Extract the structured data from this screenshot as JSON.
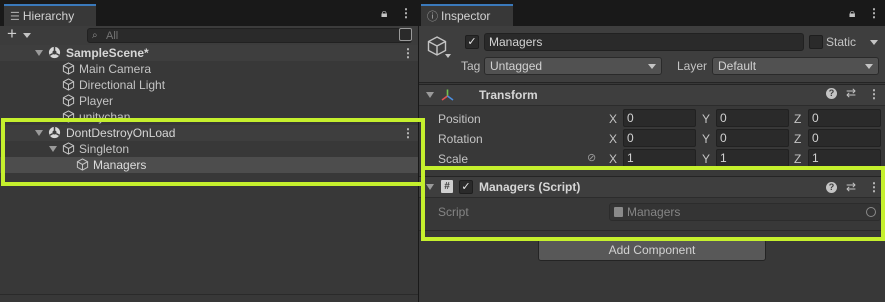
{
  "hierarchy": {
    "tab_label": "Hierarchy",
    "add_label": "+",
    "search_placeholder": "All",
    "tree": [
      {
        "label": "SampleScene*"
      },
      {
        "label": "Main Camera"
      },
      {
        "label": "Directional Light"
      },
      {
        "label": "Player"
      },
      {
        "label": "unitychan"
      },
      {
        "label": "DontDestroyOnLoad"
      },
      {
        "label": "Singleton"
      },
      {
        "label": "Managers"
      }
    ]
  },
  "inspector": {
    "tab_label": "Inspector",
    "object_name": "Managers",
    "static_label": "Static",
    "tag_label": "Tag",
    "tag_value": "Untagged",
    "layer_label": "Layer",
    "layer_value": "Default",
    "transform": {
      "title": "Transform",
      "rows": [
        {
          "label": "Position",
          "x": "0",
          "y": "0",
          "z": "0"
        },
        {
          "label": "Rotation",
          "x": "0",
          "y": "0",
          "z": "0"
        },
        {
          "label": "Scale",
          "x": "1",
          "y": "1",
          "z": "1"
        }
      ],
      "axes": {
        "x": "X",
        "y": "Y",
        "z": "Z"
      }
    },
    "script_component": {
      "title": "Managers (Script)",
      "script_label": "Script",
      "script_value": "Managers"
    },
    "add_component_label": "Add Component"
  },
  "colors": {
    "highlight": "#c5f02d",
    "panel_bg": "#383838",
    "selected_row": "#4d4d4d",
    "accent_tab": "#3a79bb"
  }
}
